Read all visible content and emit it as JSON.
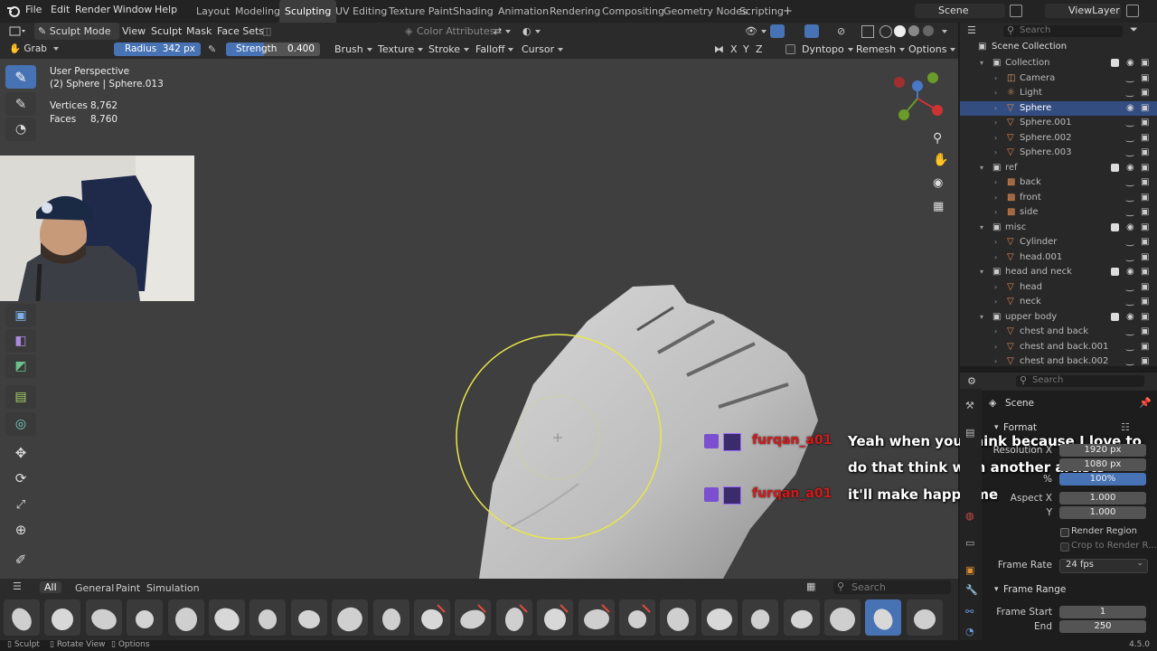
{
  "app": {
    "menus": [
      "File",
      "Edit",
      "Render",
      "Window",
      "Help"
    ],
    "workspaces": [
      "Layout",
      "Modeling",
      "Sculpting",
      "UV Editing",
      "Texture Paint",
      "Shading",
      "Animation",
      "Rendering",
      "Compositing",
      "Geometry Nodes",
      "Scripting"
    ],
    "active_workspace": "Sculpting",
    "scene": "Scene",
    "view_layer": "ViewLayer",
    "version": "4.5.0"
  },
  "header": {
    "mode": "Sculpt Mode",
    "menus": [
      "View",
      "Sculpt",
      "Mask",
      "Face Sets"
    ],
    "color_attributes": "Color Attributes"
  },
  "tool_header": {
    "tool": "Grab",
    "radius_label": "Radius",
    "radius_value": "342 px",
    "strength_label": "Strength",
    "strength_value": "0.400",
    "menus": [
      "Brush",
      "Texture",
      "Stroke",
      "Falloff",
      "Cursor"
    ],
    "axes": [
      "X",
      "Y",
      "Z"
    ],
    "dyntopo": "Dyntopo",
    "remesh": "Remesh",
    "options": "Options"
  },
  "viewport": {
    "perspective": "User Perspective",
    "object": "(2) Sphere | Sphere.013",
    "stats": [
      {
        "label": "Vertices",
        "value": "8,762"
      },
      {
        "label": "Faces",
        "value": "8,760"
      }
    ]
  },
  "chat": [
    {
      "user": "furqan_a01",
      "message_lines": [
        "Yeah when you think because I love to",
        "do that think with another artists"
      ]
    },
    {
      "user": "furqan_a01",
      "message_lines": [
        "it'll make happy me"
      ]
    }
  ],
  "shelf": {
    "tabs": [
      "All",
      "General",
      "Paint",
      "Simulation"
    ],
    "active_tab": "All",
    "search_placeholder": "Search"
  },
  "status": [
    "Sculpt",
    "Rotate View",
    "Options"
  ],
  "outliner": {
    "search_placeholder": "Search",
    "root": "Scene Collection",
    "rows": [
      {
        "label": "Collection",
        "type": "collection"
      },
      {
        "label": "Camera",
        "type": "camera"
      },
      {
        "label": "Light",
        "type": "light"
      },
      {
        "label": "Sphere",
        "type": "mesh",
        "selected": true
      },
      {
        "label": "Sphere.001",
        "type": "mesh"
      },
      {
        "label": "Sphere.002",
        "type": "mesh"
      },
      {
        "label": "Sphere.003",
        "type": "mesh"
      },
      {
        "label": "ref",
        "type": "collection"
      },
      {
        "label": "back",
        "type": "image"
      },
      {
        "label": "front",
        "type": "image"
      },
      {
        "label": "side",
        "type": "image"
      },
      {
        "label": "misc",
        "type": "collection"
      },
      {
        "label": "Cylinder",
        "type": "mesh"
      },
      {
        "label": "head.001",
        "type": "mesh"
      },
      {
        "label": "head and neck",
        "type": "collection"
      },
      {
        "label": "head",
        "type": "mesh"
      },
      {
        "label": "neck",
        "type": "mesh"
      },
      {
        "label": "upper body",
        "type": "collection"
      },
      {
        "label": "chest and back",
        "type": "mesh"
      },
      {
        "label": "chest and back.001",
        "type": "mesh"
      },
      {
        "label": "chest and back.002",
        "type": "mesh"
      }
    ]
  },
  "properties": {
    "search_placeholder": "Search",
    "breadcrumb": "Scene",
    "format_panel": "Format",
    "resolution_x_label": "Resolution X",
    "resolution_x": "1920 px",
    "resolution_y": "1080 px",
    "percent_label": "%",
    "percent": "100%",
    "aspect_x_label": "Aspect X",
    "aspect_x": "1.000",
    "aspect_y_label": "Y",
    "aspect_y": "1.000",
    "render_region": "Render Region",
    "crop": "Crop to Render R...",
    "frame_rate_label": "Frame Rate",
    "frame_rate": "24 fps",
    "frame_range_panel": "Frame Range",
    "frame_start_label": "Frame Start",
    "frame_start": "1",
    "end_label": "End",
    "end": "250"
  },
  "colors": {
    "accent": "#4772b3",
    "selected": "#334d80",
    "brush_circle": "#e8e84a",
    "chat_user": "#d21a1a"
  }
}
